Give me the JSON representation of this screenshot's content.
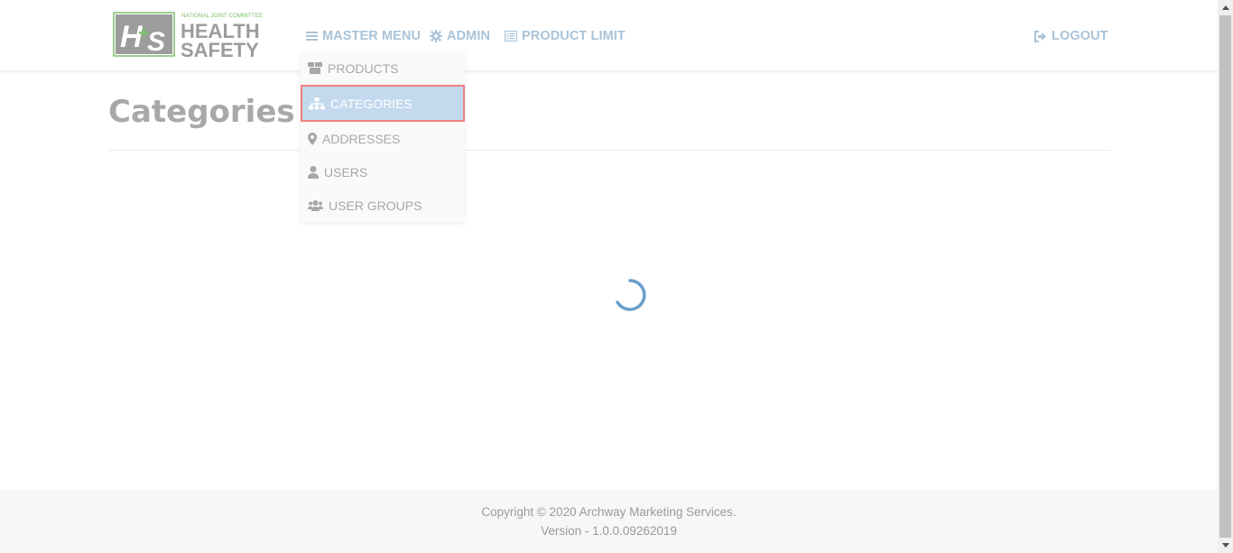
{
  "brand": {
    "logo_initials": "H+S",
    "logo_tagline": "NATIONAL JOINT COMMITTEE",
    "logo_line1": "HEALTH",
    "logo_line2": "SAFETY",
    "logo_green": "#7bbf6a",
    "logo_gray": "#9c9c9c"
  },
  "nav": {
    "master_menu": "MASTER MENU",
    "admin": "ADMIN",
    "product_limit": "PRODUCT LIMIT",
    "logout": "LOGOUT",
    "link_color": "#a9c3d8"
  },
  "dropdown": {
    "items": [
      {
        "label": "PRODUCTS",
        "icon": "boxes-icon"
      },
      {
        "label": "CATEGORIES",
        "icon": "sitemap-icon",
        "active": true
      },
      {
        "label": "ADDRESSES",
        "icon": "map-marker-icon"
      },
      {
        "label": "USERS",
        "icon": "user-icon"
      },
      {
        "label": "USER GROUPS",
        "icon": "users-icon"
      }
    ]
  },
  "page": {
    "title": "Categories",
    "loading": true
  },
  "footer": {
    "copyright": "Copyright © 2020 Archway Marketing Services.",
    "version": "Version - 1.0.0.09262019"
  },
  "colors": {
    "accent": "#4aa3e0",
    "active_item_bg": "#c3d9ee",
    "active_item_border": "#f08080",
    "spinner": "#6a9fcc"
  }
}
